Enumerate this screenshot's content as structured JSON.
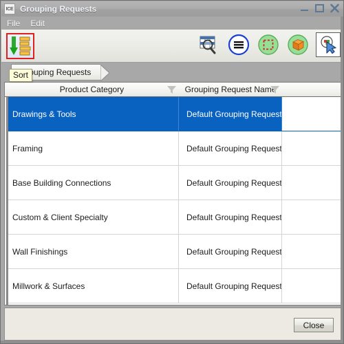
{
  "window": {
    "app_icon_label": "ICE",
    "title": "Grouping Requests",
    "controls": [
      {
        "name": "minimize",
        "label": "Minimize"
      },
      {
        "name": "maximize",
        "label": "Maximize"
      },
      {
        "name": "close",
        "label": "Close"
      }
    ]
  },
  "menubar": {
    "items": [
      {
        "label": "File"
      },
      {
        "label": "Edit"
      }
    ]
  },
  "toolbar": {
    "left": [
      {
        "name": "sort-button",
        "label": "Sort",
        "icon": "sort-descending-icon",
        "highlighted": true,
        "highlight_color": "#e02020"
      }
    ],
    "right": [
      {
        "name": "zoom-table-button",
        "label": "Zoom Table",
        "icon": "magnifier-table-icon"
      },
      {
        "name": "list-menu-button",
        "label": "List",
        "icon": "hamburger-circle-icon"
      },
      {
        "name": "select-region-button",
        "label": "Select Region",
        "icon": "dashed-square-circle-icon"
      },
      {
        "name": "model-object-button",
        "label": "Model Object",
        "icon": "orange-cube-circle-icon"
      },
      {
        "name": "pick-tool-button",
        "label": "Pick",
        "icon": "pick-cursor-icon"
      }
    ]
  },
  "tooltip": {
    "text": "Sort",
    "background": "#fdfbd8"
  },
  "tabs": [
    {
      "label": "Grouping Requests",
      "active": true
    }
  ],
  "grid": {
    "columns": [
      {
        "label": "Product Category",
        "filter_icon": "filter-funnel-icon"
      },
      {
        "label": "Grouping Request Name",
        "filter_icon": "filter-funnel-icon"
      },
      {
        "label": "",
        "filter_icon": ""
      }
    ],
    "selection_color": "#0a62c0",
    "rows": [
      {
        "product_category": "Drawings & Tools",
        "grouping_request_name": "Default Grouping Request",
        "selected": true
      },
      {
        "product_category": "Framing",
        "grouping_request_name": "Default Grouping Request",
        "selected": false
      },
      {
        "product_category": "Base Building Connections",
        "grouping_request_name": "Default Grouping Request",
        "selected": false
      },
      {
        "product_category": "Custom & Client Specialty",
        "grouping_request_name": "Default Grouping Request",
        "selected": false
      },
      {
        "product_category": "Wall Finishings",
        "grouping_request_name": "Default Grouping Request",
        "selected": false
      },
      {
        "product_category": "Millwork & Surfaces",
        "grouping_request_name": "Default Grouping Request",
        "selected": false
      }
    ]
  },
  "footer": {
    "close_label": "Close"
  }
}
